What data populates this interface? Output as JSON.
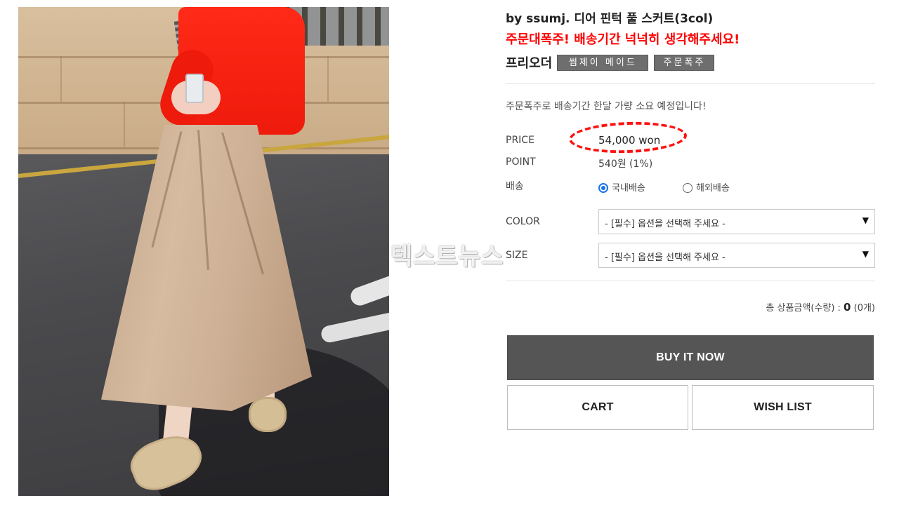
{
  "product": {
    "title": "by ssumj. 디어 핀턱 풀 스커트(3col)",
    "alert": "주문대폭주! 배송기간 넉넉히 생각해주세요!",
    "preorder": "프리오더",
    "tags": [
      "썸제이 메이드",
      "주문폭주"
    ],
    "notice": "주문폭주로 배송기간 한달 가량 소요 예정입니다!"
  },
  "fields": {
    "price_label": "PRICE",
    "price_value": "54,000 won",
    "point_label": "POINT",
    "point_value": "540원 (1%)",
    "shipping_label": "배송",
    "shipping_options": [
      "국내배송",
      "해외배송"
    ],
    "shipping_selected": "국내배송",
    "color_label": "COLOR",
    "color_placeholder": "- [필수] 옵션을 선택해 주세요 -",
    "size_label": "SIZE",
    "size_placeholder": "- [필수] 옵션을 선택해 주세요 -",
    "dropdown_arrow": "▼"
  },
  "total": {
    "label": "총 상품금액(수량) :",
    "amount": "0",
    "count": "(0개)"
  },
  "buttons": {
    "buy": "BUY IT NOW",
    "cart": "CART",
    "wishlist": "WISH LIST"
  },
  "watermark": "텍스트뉴스",
  "colors": {
    "alert": "#ff0000",
    "buy_button": "#555555",
    "tag_bg": "#6e6e6e",
    "highlight_circle": "#ff1010",
    "radio_selected": "#1a73e8"
  },
  "icons": {
    "dropdown": "chevron-down-icon",
    "radio_on": "radio-selected-icon",
    "radio_off": "radio-unselected-icon"
  }
}
